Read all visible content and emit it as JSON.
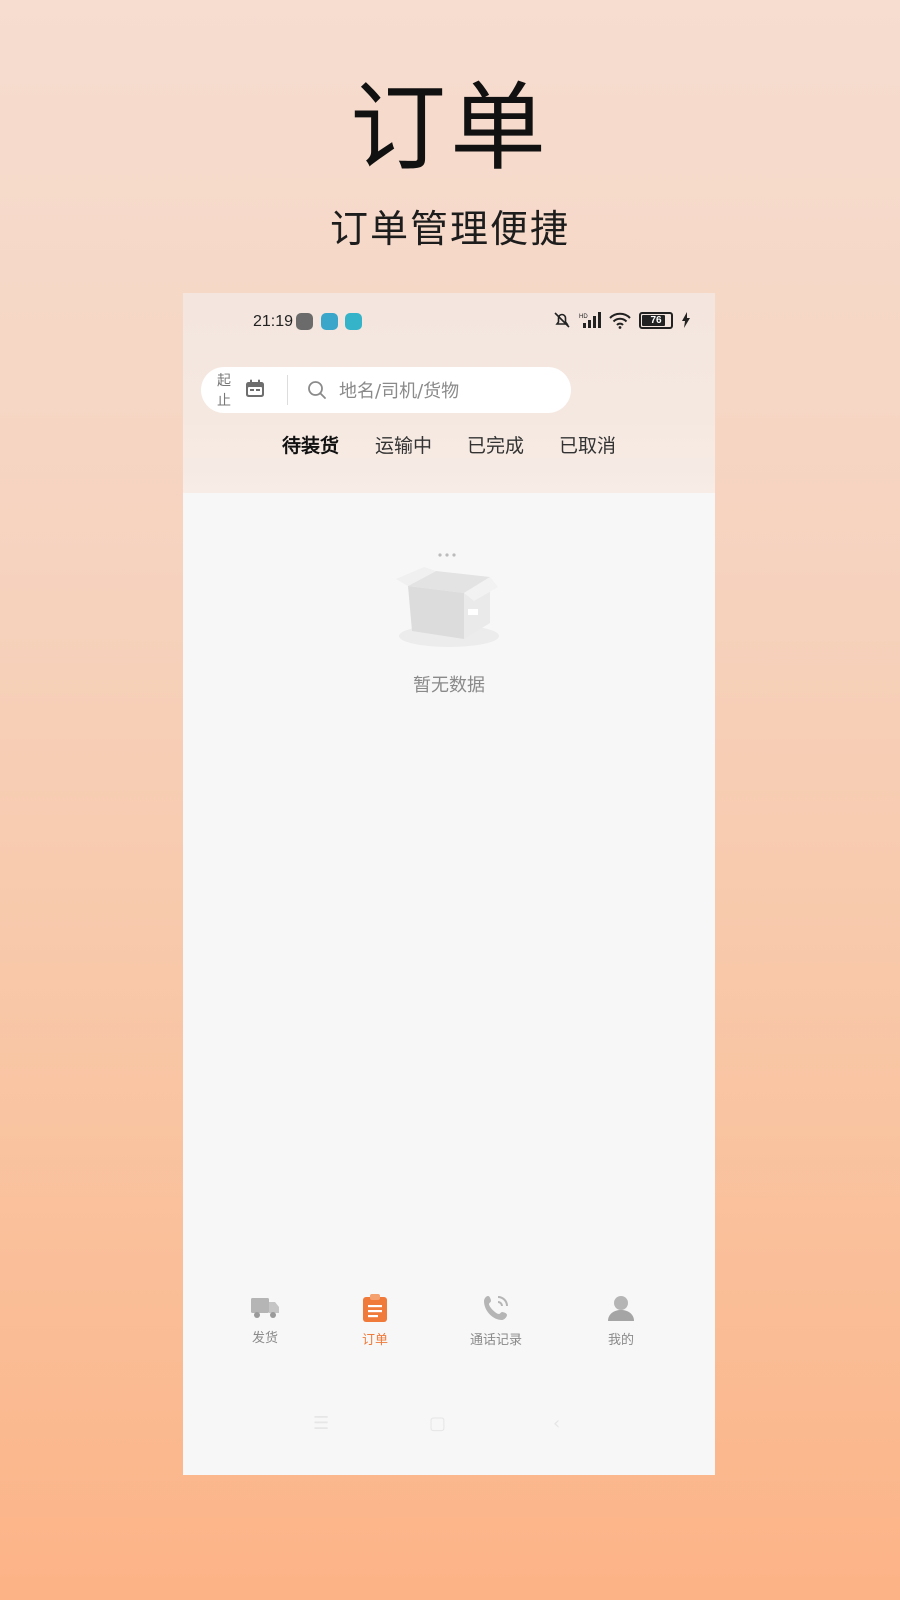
{
  "hero": {
    "title": "订单",
    "subtitle": "订单管理便捷"
  },
  "status_bar": {
    "time": "21:19",
    "battery": "76"
  },
  "filter": {
    "date_label_top": "起",
    "date_label_bottom": "止",
    "search_placeholder": "地名/司机/货物"
  },
  "tabs": [
    {
      "label": "待装货",
      "active": true
    },
    {
      "label": "运输中",
      "active": false
    },
    {
      "label": "已完成",
      "active": false
    },
    {
      "label": "已取消",
      "active": false
    }
  ],
  "empty_state": {
    "text": "暂无数据"
  },
  "bottom_nav": [
    {
      "label": "发货",
      "icon": "truck-icon",
      "active": false
    },
    {
      "label": "订单",
      "icon": "clipboard-icon",
      "active": true
    },
    {
      "label": "通话记录",
      "icon": "phone-icon",
      "active": false
    },
    {
      "label": "我的",
      "icon": "user-icon",
      "active": false
    }
  ],
  "colors": {
    "accent": "#ef7a3a",
    "inactive": "#8a8a8a",
    "background_gradient_top": "#f6ddd0",
    "background_gradient_bottom": "#fcb386"
  }
}
